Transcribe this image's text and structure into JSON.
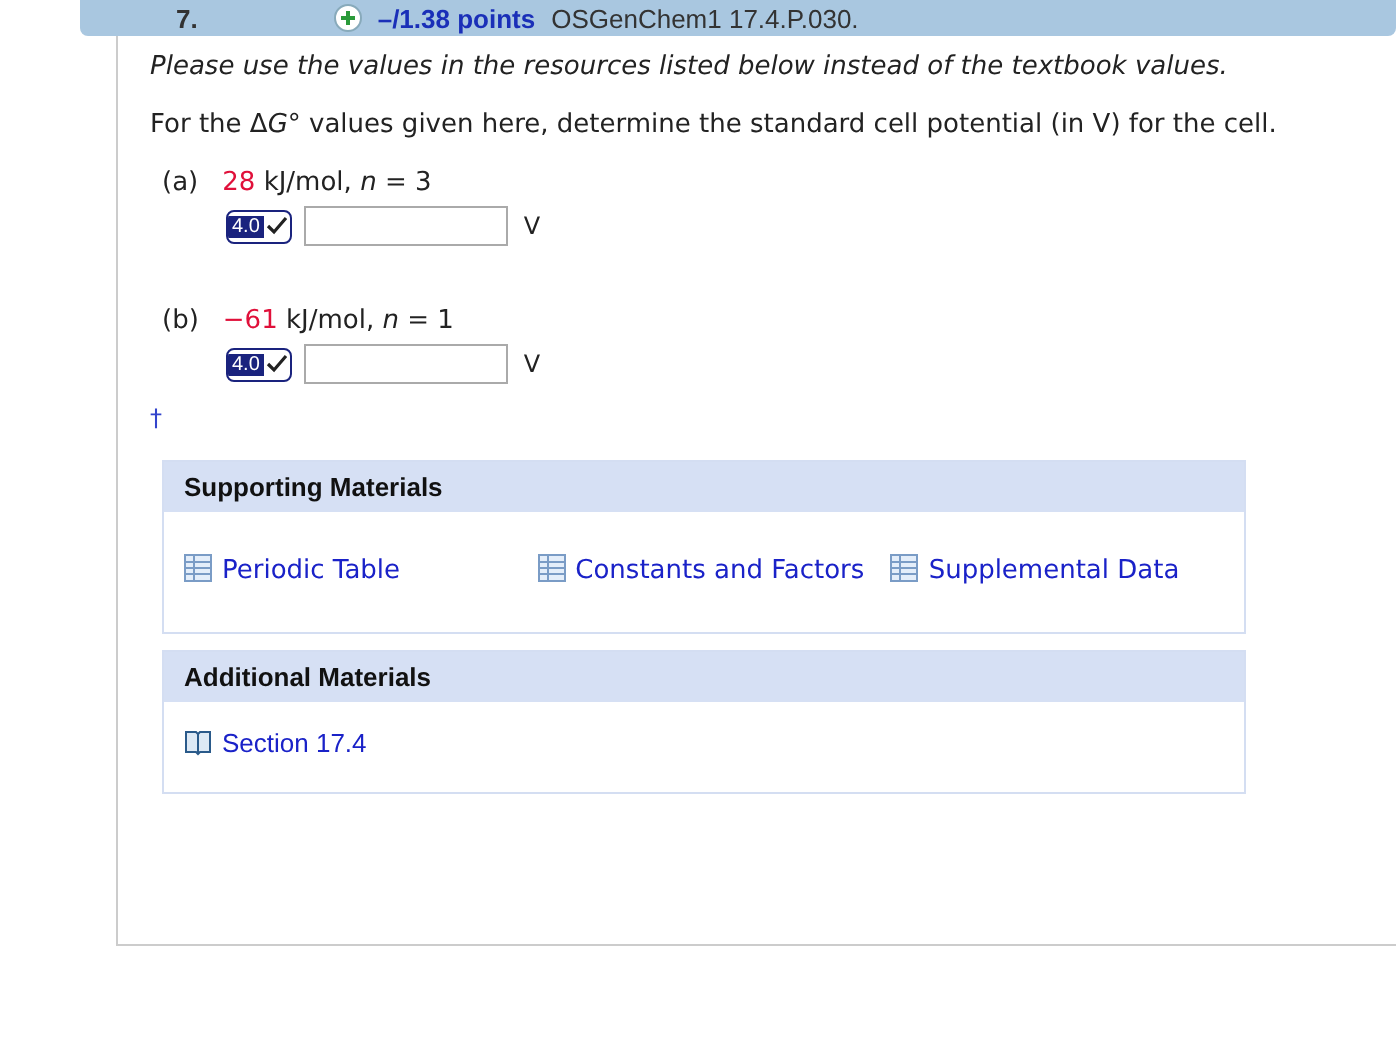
{
  "header": {
    "number": "7.",
    "points": "–/1.38 points",
    "code": "OSGenChem1 17.4.P.030."
  },
  "instruction": "Please use the values in the resources listed below instead of the textbook values.",
  "question": {
    "before": "For the Δ",
    "symbol": "G",
    "after": "° values given here, determine the standard cell potential (in V) for the cell."
  },
  "parts": [
    {
      "label": "(a)",
      "value": "28",
      "text": "kJ/mol, *n* = 3",
      "badge": "4.0",
      "unit": "V"
    },
    {
      "label": "(b)",
      "value": "−61",
      "text": "kJ/mol, *n* = 1",
      "badge": "4.0",
      "unit": "V"
    }
  ],
  "footnote_mark": "†",
  "supporting": {
    "title": "Supporting Materials",
    "links": [
      "Periodic Table",
      "Constants and Factors",
      "Supplemental Data"
    ]
  },
  "additional": {
    "title": "Additional Materials",
    "links": [
      "Section 17.4"
    ]
  }
}
